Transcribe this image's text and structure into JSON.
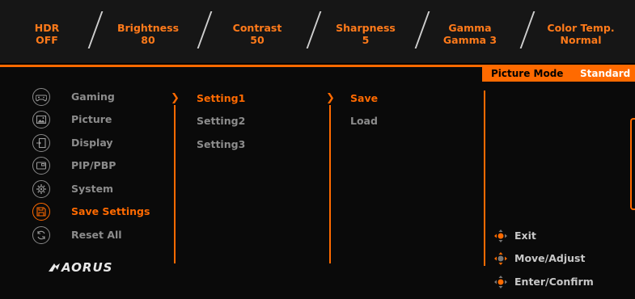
{
  "status_bar": [
    {
      "label": "HDR",
      "value": "OFF"
    },
    {
      "label": "Brightness",
      "value": "80"
    },
    {
      "label": "Contrast",
      "value": "50"
    },
    {
      "label": "Sharpness",
      "value": "5"
    },
    {
      "label": "Gamma",
      "value": "Gamma 3"
    },
    {
      "label": "Color Temp.",
      "value": "Normal"
    }
  ],
  "picture_mode": {
    "label": "Picture Mode",
    "value": "Standard"
  },
  "menu": [
    {
      "label": "Gaming",
      "icon": "gamepad-icon"
    },
    {
      "label": "Picture",
      "icon": "picture-icon"
    },
    {
      "label": "Display",
      "icon": "display-input-icon"
    },
    {
      "label": "PIP/PBP",
      "icon": "pip-icon"
    },
    {
      "label": "System",
      "icon": "gear-icon"
    },
    {
      "label": "Save Settings",
      "icon": "save-icon"
    },
    {
      "label": "Reset All",
      "icon": "reset-icon"
    }
  ],
  "submenu": [
    "Setting1",
    "Setting2",
    "Setting3"
  ],
  "actions": [
    "Save",
    "Load"
  ],
  "hints": [
    {
      "label": "Exit",
      "icon": "joystick-left-icon"
    },
    {
      "label": "Move/Adjust",
      "icon": "joystick-move-icon"
    },
    {
      "label": "Enter/Confirm",
      "icon": "joystick-press-icon"
    }
  ],
  "brand": "AORUS",
  "colors": {
    "accent": "#ff6a00",
    "inactive": "#8c8c8c",
    "background": "#0a0a0a"
  }
}
